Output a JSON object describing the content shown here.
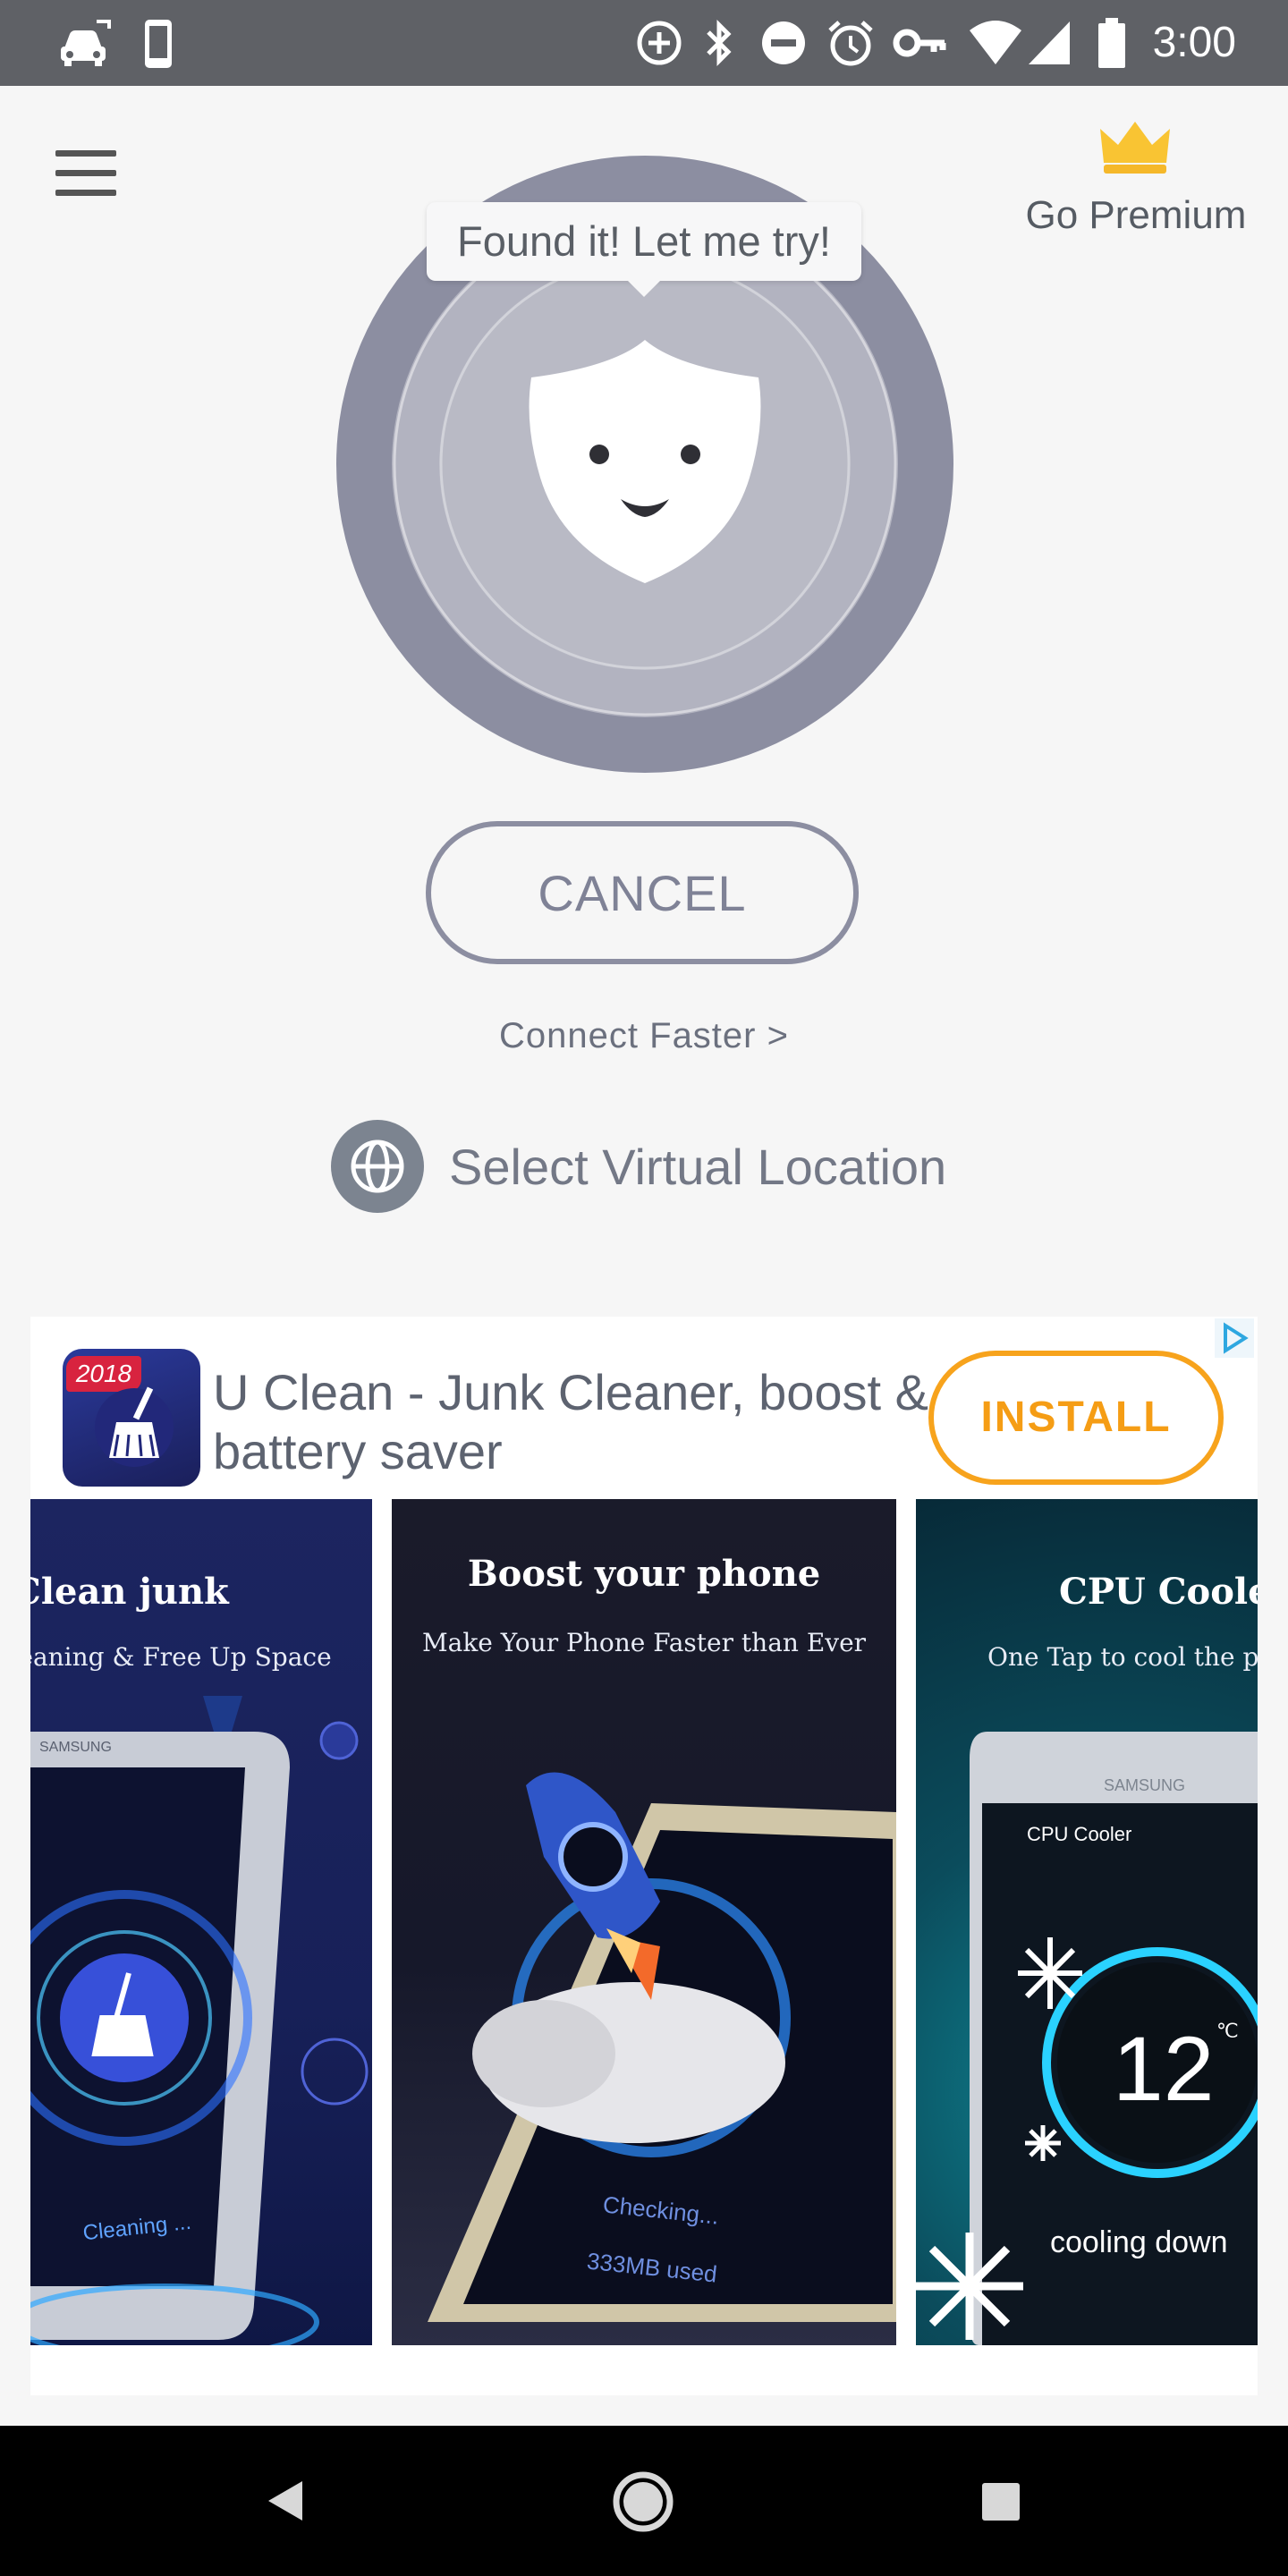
{
  "status_bar": {
    "time": "3:00",
    "left_icons": [
      "car-icon",
      "phone-icon"
    ],
    "right_icons": [
      "data-saver-icon",
      "bluetooth-icon",
      "do-not-disturb-icon",
      "alarm-icon",
      "vpn-key-icon",
      "wifi-icon",
      "cell-signal-icon",
      "battery-icon"
    ]
  },
  "header": {
    "menu_icon": "hamburger-menu-icon",
    "premium_label": "Go Premium",
    "premium_icon": "crown-icon",
    "accent_color": "#f9c433"
  },
  "connect": {
    "tooltip": "Found it! Let me try!",
    "cancel_label": "CANCEL",
    "connect_faster": "Connect Faster >",
    "virtual_location": "Select Virtual Location",
    "ring_color": "#8c8ea1"
  },
  "ad": {
    "app_badge": "2018",
    "title": "U Clean - Junk Cleaner, boost & battery saver",
    "install_label": "INSTALL",
    "install_color": "#f7a31c",
    "screenshots": [
      {
        "title": "Clean junk",
        "subtitle": "Cleaning & Free Up Space",
        "device_brand": "SAMSUNG",
        "status_text": "Cleaning ..."
      },
      {
        "title": "Boost your phone",
        "subtitle": "Make Your Phone Faster than Ever",
        "status_text": "Checking...",
        "usage_text": "333MB used"
      },
      {
        "title": "CPU Coole",
        "subtitle": "One Tap to cool the pho",
        "device_brand": "SAMSUNG",
        "screen_title": "CPU Cooler",
        "temperature": "12",
        "temperature_unit": "℃",
        "status_text": "cooling down"
      }
    ]
  },
  "nav_bar": {
    "back_icon": "back-icon",
    "home_icon": "home-icon",
    "recents_icon": "recents-icon"
  }
}
